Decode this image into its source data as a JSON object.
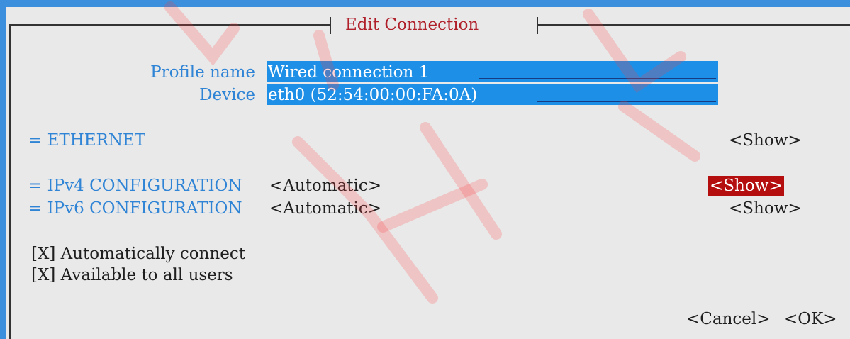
{
  "dialog": {
    "title": "Edit Connection"
  },
  "profile": {
    "label": "Profile name",
    "value": "Wired connection 1"
  },
  "device": {
    "label": "Device",
    "value": "eth0 (52:54:00:00:FA:0A)"
  },
  "ethernet": {
    "label": "= ETHERNET",
    "show": "<Show>"
  },
  "ipv4": {
    "label": "= IPv4 CONFIGURATION",
    "mode": "<Automatic>",
    "show": "<Show>"
  },
  "ipv6": {
    "label": "= IPv6 CONFIGURATION",
    "mode": "<Automatic>",
    "show": "<Show>"
  },
  "options": {
    "autoconnect": "[X] Automatically connect",
    "all_users": "[X] Available to all users"
  },
  "buttons": {
    "cancel": "<Cancel>",
    "ok": "<OK>"
  },
  "colors": {
    "accent": "#3c8fdc",
    "field": "#1e8fe6",
    "active_button": "#b40e0e",
    "title": "#b0202a"
  }
}
